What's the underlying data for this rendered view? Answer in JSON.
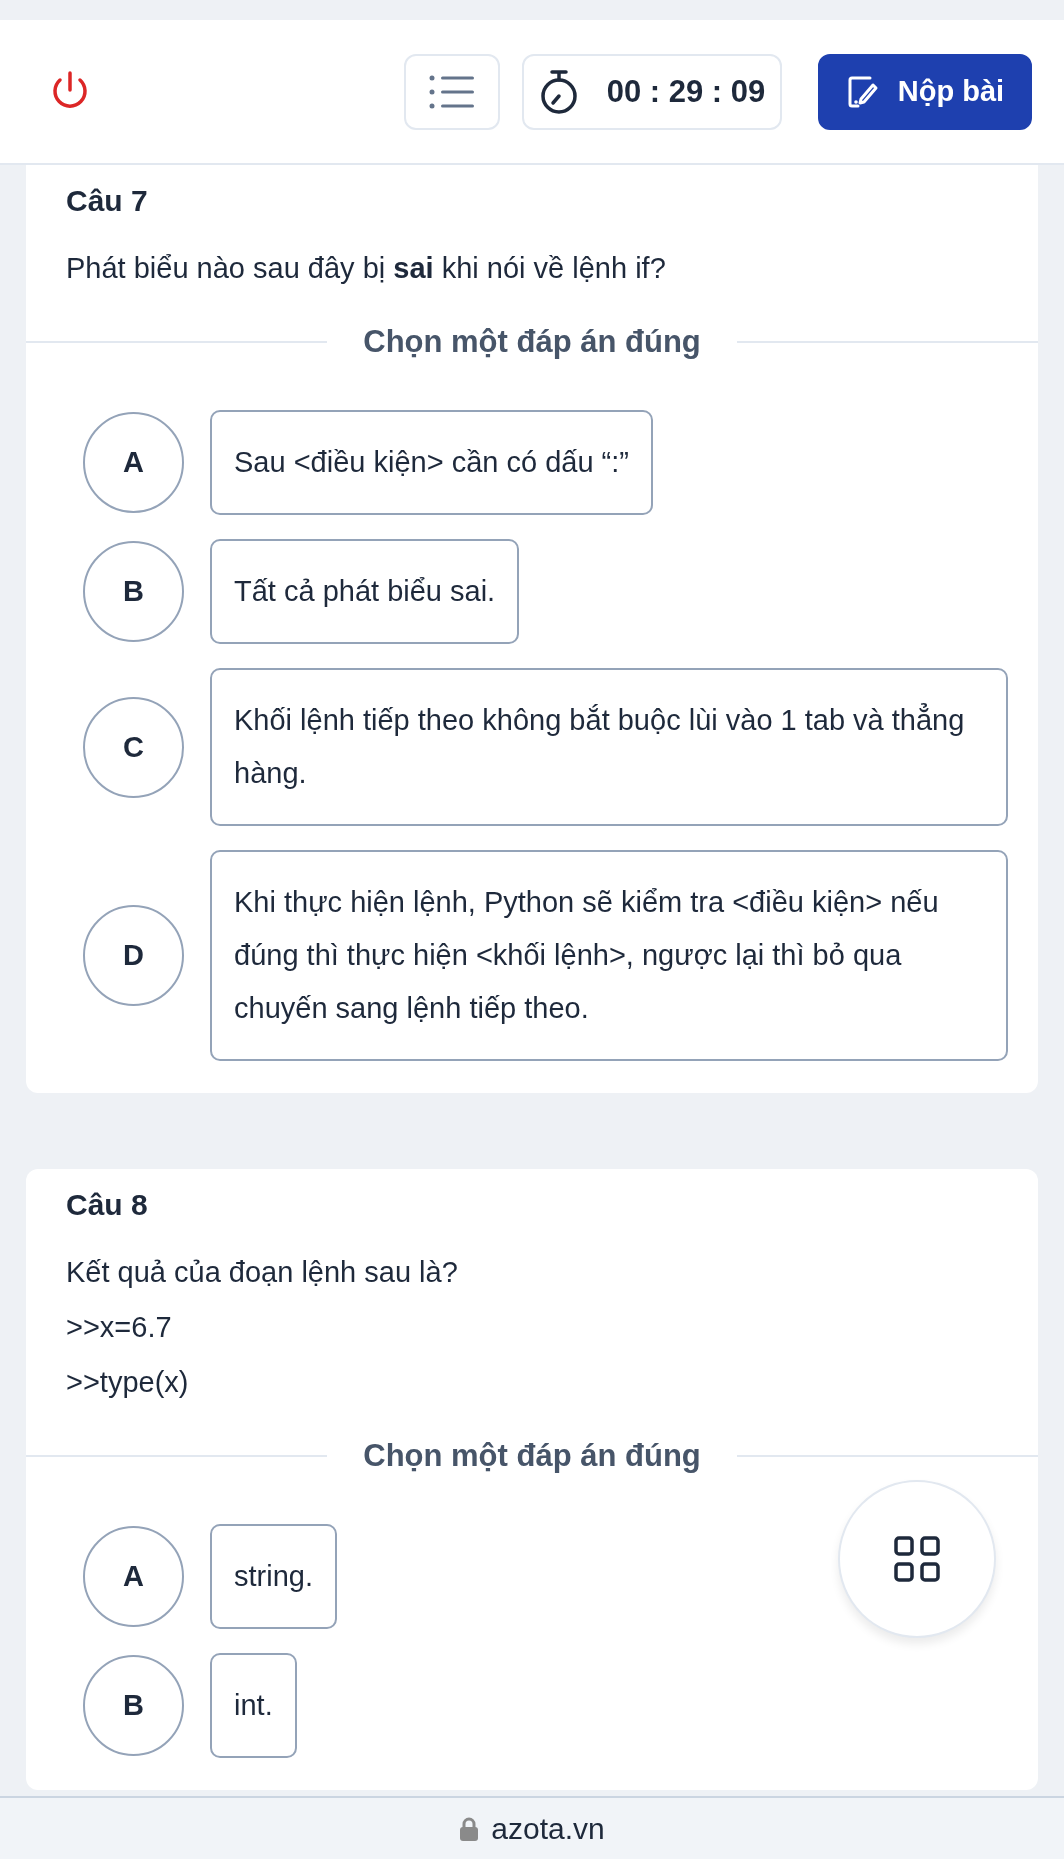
{
  "header": {
    "timer": "00 : 29 : 09",
    "submit_label": "Nộp bài"
  },
  "questions": [
    {
      "title": "Câu 7",
      "prompt": [
        "Phát biểu nào sau đây bị **sai** khi nói về lệnh if?"
      ],
      "instruction": "Chọn một đáp án đúng",
      "options": [
        {
          "letter": "A",
          "text": "Sau <điều kiện> cần có dấu “:”",
          "selected": false
        },
        {
          "letter": "B",
          "text": "Tất cả phát biểu sai.",
          "selected": false
        },
        {
          "letter": "C",
          "text": "Khối lệnh tiếp theo không bắt buộc lùi vào 1 tab và thẳng hàng.",
          "selected": false
        },
        {
          "letter": "D",
          "text": "Khi thực hiện lệnh, Python sẽ kiểm tra <điều kiện> nếu đúng thì thực hiện <khối lệnh>, ngược lại thì bỏ qua chuyến sang lệnh tiếp theo.",
          "selected": false
        }
      ]
    },
    {
      "title": "Câu 8",
      "prompt": [
        "Kết quả của đoạn lệnh sau là?",
        ">>x=6.7",
        ">>type(x)"
      ],
      "instruction": "Chọn một đáp án đúng",
      "options": [
        {
          "letter": "A",
          "text": "string.",
          "selected": false
        },
        {
          "letter": "B",
          "text": "int.",
          "selected": false
        }
      ]
    }
  ],
  "address_bar": {
    "domain": "azota.vn"
  }
}
